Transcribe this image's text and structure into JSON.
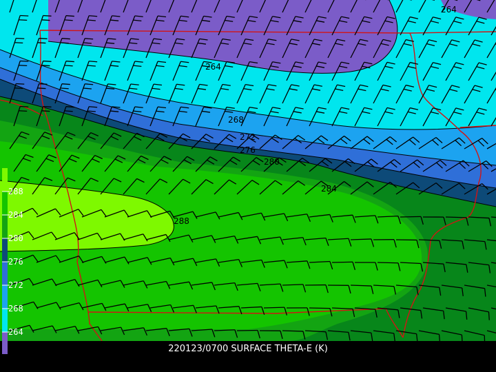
{
  "caption": "220123/0700 SURFACE THETA-E (K)",
  "colors": {
    "purple": "#7b5cc8",
    "cyan": "#00e6ee",
    "blue_light": "#1ca3f0",
    "blue_mid": "#2f6fd8",
    "navy": "#0d4a78",
    "green_dark": "#07861a",
    "green_mid": "#13a412",
    "green_bright": "#14c400",
    "lime": "#7ef900",
    "border": "#d21414",
    "barb": "#000000"
  },
  "contour_labels": [
    "264",
    "264",
    "268",
    "272",
    "276",
    "280",
    "284",
    "288"
  ],
  "colorbar": {
    "labels": [
      "288",
      "284",
      "280",
      "276",
      "272",
      "268",
      "264"
    ]
  }
}
